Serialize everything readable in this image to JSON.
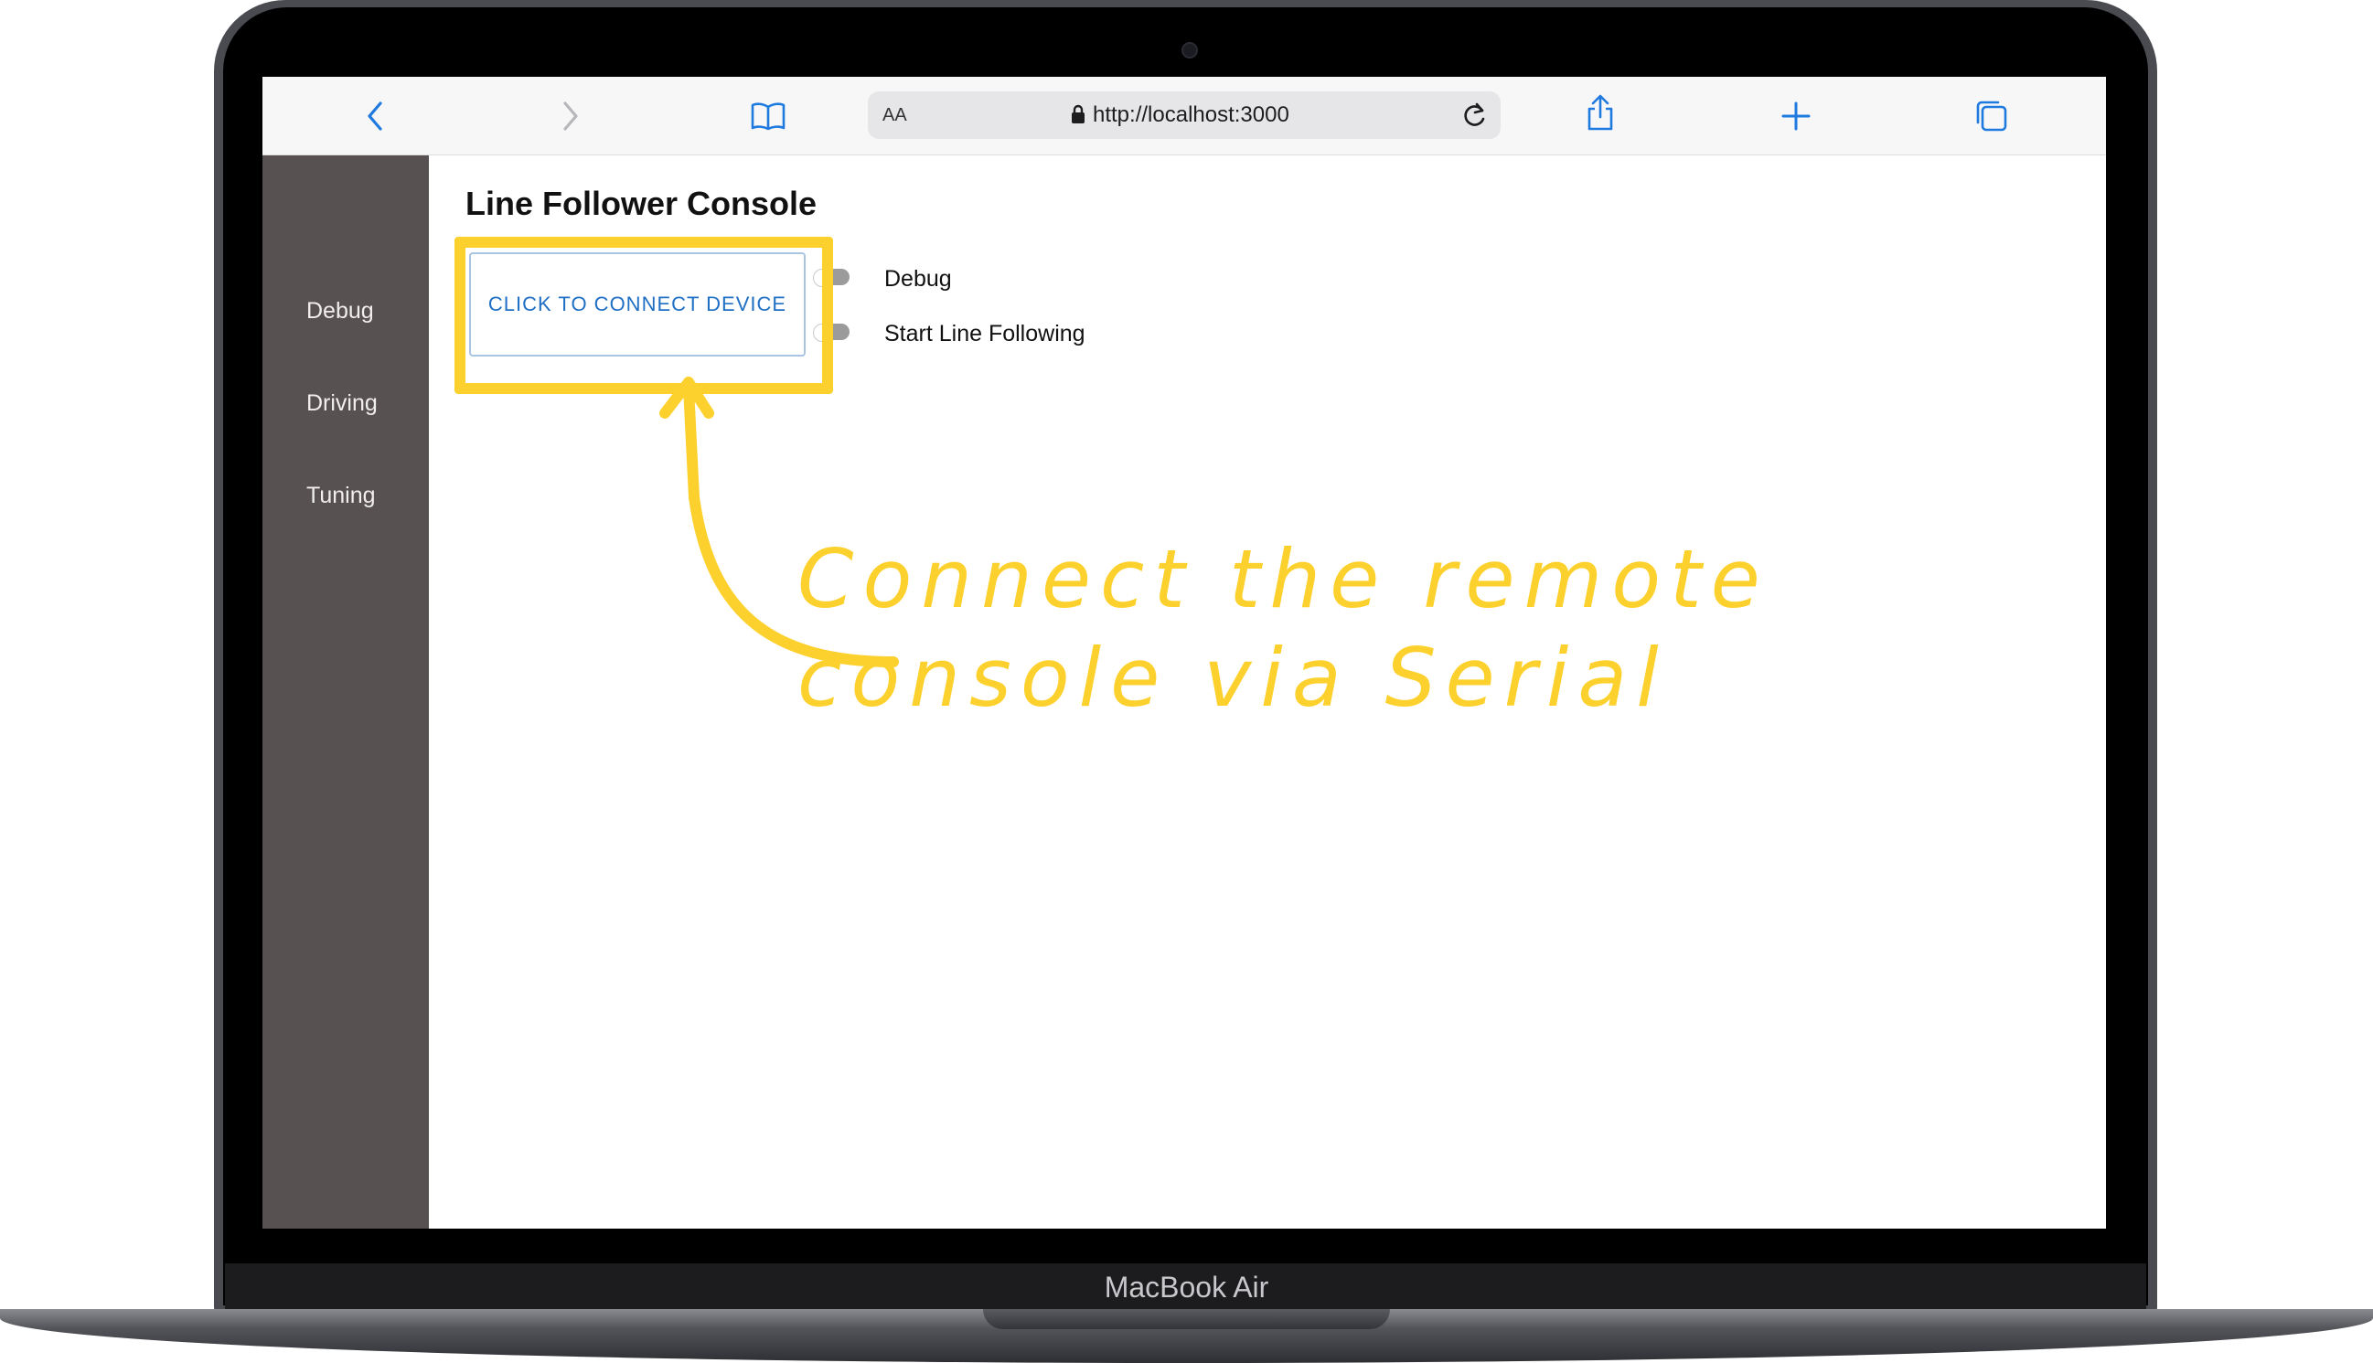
{
  "device": {
    "brand_label": "MacBook Air"
  },
  "browser": {
    "text_size_label": "AA",
    "url": "http://localhost:3000",
    "icons": [
      "back-icon",
      "forward-icon",
      "bookmarks-icon",
      "lock-icon",
      "reload-icon",
      "share-icon",
      "new-tab-icon",
      "tabs-icon"
    ],
    "accent_color": "#1f7ae0"
  },
  "sidebar": {
    "items": [
      {
        "label": "Debug"
      },
      {
        "label": "Driving"
      },
      {
        "label": "Tuning"
      }
    ]
  },
  "main": {
    "title": "Line Follower Console",
    "connect_button_label": "CLICK TO CONNECT DEVICE",
    "toggles": [
      {
        "label": "Debug",
        "on": false
      },
      {
        "label": "Start Line Following",
        "on": false
      }
    ]
  },
  "annotation": {
    "line1": "Connect the remote",
    "line2": "console via Serial",
    "color": "#fdd12d"
  }
}
